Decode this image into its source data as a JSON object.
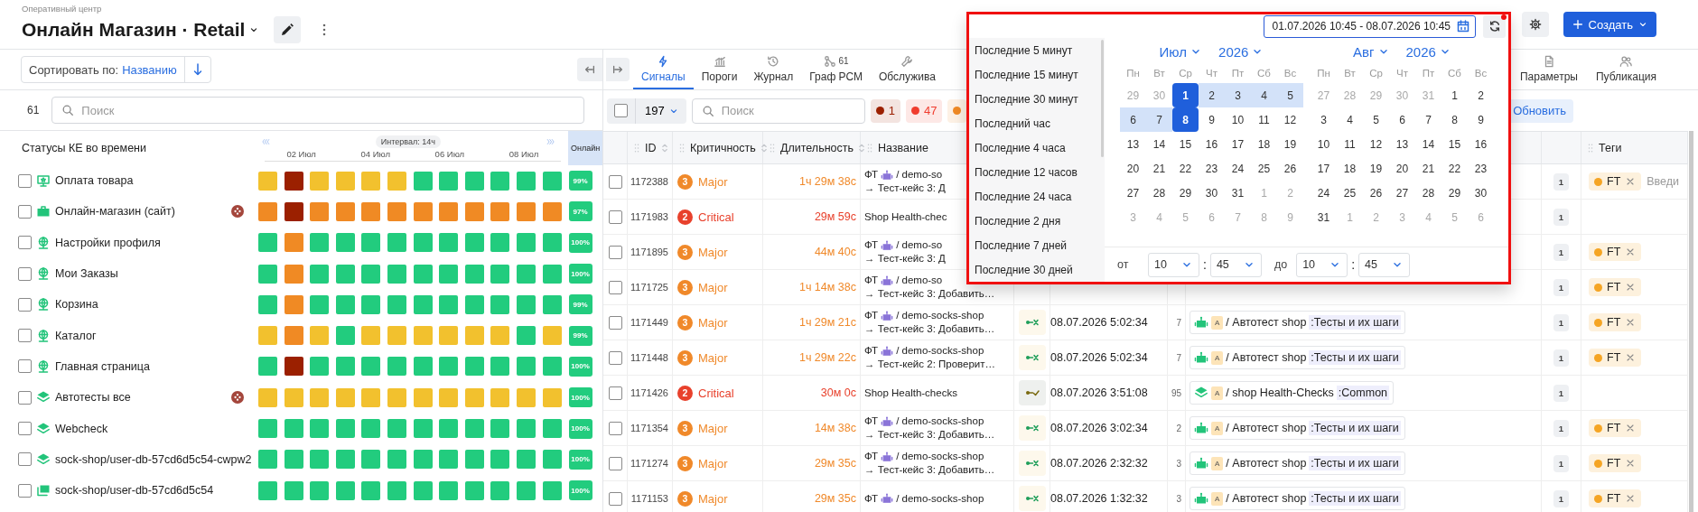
{
  "header": {
    "breadcrumb": "Оперативный центр",
    "title": "Онлайн Магазин · Retail",
    "create_button": "Создать"
  },
  "sort": {
    "label": "Сортировать по:",
    "value": "Названию"
  },
  "status_panel": {
    "count": "61",
    "search_placeholder": "Поиск",
    "title": "Статусы КЕ во времени",
    "interval": "Интервал: 14ч",
    "ticks": [
      "02 Июл",
      "04 Июл",
      "06 Июл",
      "08 Июл"
    ],
    "online_header": "Онлайн"
  },
  "status_rows": [
    {
      "name": "Оплата товара",
      "kind": "monitor",
      "checked": false,
      "alert": false,
      "uptime": "99%",
      "cells": [
        {
          "color": "#f2c12e"
        },
        {
          "color": "#9b2000"
        },
        {
          "color": "#f2c12e"
        },
        {
          "color": "#f2c12e"
        },
        {
          "color": "#f2c12e"
        },
        {
          "color": "#f2c12e"
        },
        {
          "color": "#22cc7e"
        },
        {
          "color": "#22cc7e"
        },
        {
          "color": "#22cc7e"
        },
        {
          "color": "#22cc7e"
        },
        {
          "color": "#22cc7e"
        },
        {
          "color": "#22cc7e"
        }
      ]
    },
    {
      "name": "Онлайн-магазин (сайт)",
      "kind": "briefcase",
      "checked": false,
      "alert": true,
      "uptime": "97%",
      "cells": [
        {
          "color": "#f08a24"
        },
        {
          "color": "#9b2000"
        },
        {
          "color": "#f08a24"
        },
        {
          "color": "#f08a24"
        },
        {
          "color": "#f08a24"
        },
        {
          "color": "#f08a24"
        },
        {
          "color": "#f08a24"
        },
        {
          "color": "#f08a24"
        },
        {
          "color": "#f08a24"
        },
        {
          "color": "#f08a24"
        },
        {
          "color": "#f08a24"
        },
        {
          "color": "#f08a24"
        }
      ]
    },
    {
      "name": "Настройки профиля",
      "kind": "globe",
      "checked": false,
      "alert": false,
      "uptime": "100%",
      "cells": [
        {
          "color": "#22cc7e"
        },
        {
          "color": "#f08a24"
        },
        {
          "color": "#22cc7e"
        },
        {
          "color": "#22cc7e"
        },
        {
          "color": "#22cc7e"
        },
        {
          "color": "#22cc7e"
        },
        {
          "color": "#22cc7e"
        },
        {
          "color": "#22cc7e"
        },
        {
          "color": "#22cc7e"
        },
        {
          "color": "#22cc7e"
        },
        {
          "color": "#22cc7e"
        },
        {
          "color": "#22cc7e"
        }
      ]
    },
    {
      "name": "Мои Заказы",
      "kind": "globe",
      "checked": false,
      "alert": false,
      "uptime": "100%",
      "cells": [
        {
          "color": "#22cc7e"
        },
        {
          "color": "#f08a24"
        },
        {
          "color": "#22cc7e"
        },
        {
          "color": "#22cc7e"
        },
        {
          "color": "#22cc7e"
        },
        {
          "color": "#22cc7e"
        },
        {
          "color": "#22cc7e"
        },
        {
          "color": "#22cc7e"
        },
        {
          "color": "#22cc7e"
        },
        {
          "color": "#22cc7e"
        },
        {
          "color": "#22cc7e"
        },
        {
          "color": "#22cc7e"
        }
      ]
    },
    {
      "name": "Корзина",
      "kind": "globe",
      "checked": false,
      "alert": false,
      "uptime": "99%",
      "cells": [
        {
          "color": "#22cc7e"
        },
        {
          "color": "#f08a24"
        },
        {
          "color": "#22cc7e"
        },
        {
          "color": "#22cc7e"
        },
        {
          "color": "#22cc7e"
        },
        {
          "color": "#22cc7e"
        },
        {
          "color": "#22cc7e"
        },
        {
          "color": "#22cc7e"
        },
        {
          "color": "#22cc7e"
        },
        {
          "color": "#22cc7e"
        },
        {
          "color": "#22cc7e"
        },
        {
          "color": "#22cc7e"
        }
      ]
    },
    {
      "name": "Каталог",
      "kind": "globe",
      "checked": false,
      "alert": false,
      "uptime": "99%",
      "cells": [
        {
          "color": "#f2c12e"
        },
        {
          "color": "#f08a24"
        },
        {
          "color": "#f2c12e"
        },
        {
          "color": "#22cc7e"
        },
        {
          "color": "#f2c12e"
        },
        {
          "color": "#f2c12e"
        },
        {
          "color": "#f2c12e"
        },
        {
          "color": "#f2c12e"
        },
        {
          "color": "#f2c12e"
        },
        {
          "color": "#f2c12e"
        },
        {
          "color": "#22cc7e"
        },
        {
          "color": "#f2c12e"
        }
      ]
    },
    {
      "name": "Главная страница",
      "kind": "globe",
      "checked": false,
      "alert": false,
      "uptime": "100%",
      "cells": [
        {
          "color": "#22cc7e"
        },
        {
          "color": "#9b2000"
        },
        {
          "color": "#22cc7e"
        },
        {
          "color": "#22cc7e"
        },
        {
          "color": "#22cc7e"
        },
        {
          "color": "#22cc7e"
        },
        {
          "color": "#22cc7e"
        },
        {
          "color": "#22cc7e"
        },
        {
          "color": "#22cc7e"
        },
        {
          "color": "#22cc7e"
        },
        {
          "color": "#22cc7e"
        },
        {
          "color": "#22cc7e"
        }
      ]
    },
    {
      "name": "Автотесты все",
      "kind": "layers",
      "checked": false,
      "alert": true,
      "uptime": "100%",
      "cells": [
        {
          "color": "#f2c12e"
        },
        {
          "color": "#f2c12e"
        },
        {
          "color": "#f2c12e"
        },
        {
          "color": "#f2c12e"
        },
        {
          "color": "#f2c12e"
        },
        {
          "color": "#f2c12e"
        },
        {
          "color": "#f2c12e"
        },
        {
          "color": "#f2c12e"
        },
        {
          "color": "#f2c12e"
        },
        {
          "color": "#f2c12e"
        },
        {
          "color": "#f2c12e"
        },
        {
          "color": "#f2c12e"
        }
      ]
    },
    {
      "name": "Webcheck",
      "kind": "layers",
      "checked": false,
      "alert": false,
      "uptime": "100%",
      "cells": [
        {
          "color": "#22cc7e"
        },
        {
          "color": "#22cc7e"
        },
        {
          "color": "#22cc7e"
        },
        {
          "color": "#22cc7e"
        },
        {
          "color": "#22cc7e"
        },
        {
          "color": "#22cc7e"
        },
        {
          "color": "#22cc7e"
        },
        {
          "color": "#22cc7e"
        },
        {
          "color": "#22cc7e"
        },
        {
          "color": "#22cc7e"
        },
        {
          "color": "#22cc7e"
        },
        {
          "color": "#22cc7e"
        }
      ]
    },
    {
      "name": "sock-shop/user-db-57cd6d5c54-cwpw2",
      "kind": "layers",
      "checked": false,
      "alert": false,
      "uptime": "100%",
      "cells": [
        {
          "color": "#22cc7e"
        },
        {
          "color": "#22cc7e"
        },
        {
          "color": "#22cc7e"
        },
        {
          "color": "#22cc7e"
        },
        {
          "color": "#22cc7e"
        },
        {
          "color": "#22cc7e"
        },
        {
          "color": "#22cc7e"
        },
        {
          "color": "#22cc7e"
        },
        {
          "color": "#22cc7e"
        },
        {
          "color": "#22cc7e"
        },
        {
          "color": "#22cc7e"
        },
        {
          "color": "#22cc7e"
        }
      ]
    },
    {
      "name": "sock-shop/user-db-57cd6d5c54",
      "kind": "windows",
      "checked": false,
      "alert": false,
      "uptime": "100%",
      "cells": [
        {
          "color": "#22cc7e"
        },
        {
          "color": "#22cc7e"
        },
        {
          "color": "#22cc7e"
        },
        {
          "color": "#22cc7e"
        },
        {
          "color": "#22cc7e"
        },
        {
          "color": "#22cc7e"
        },
        {
          "color": "#22cc7e"
        },
        {
          "color": "#22cc7e"
        },
        {
          "color": "#22cc7e"
        },
        {
          "color": "#22cc7e"
        },
        {
          "color": "#22cc7e"
        },
        {
          "color": "#22cc7e"
        }
      ]
    }
  ],
  "tabs": {
    "left": [
      {
        "kind": "bolt",
        "label": "Сигналы",
        "selected": true
      },
      {
        "kind": "bars",
        "label": "Пороги",
        "selected": false
      },
      {
        "kind": "history",
        "label": "Журнал",
        "selected": false
      },
      {
        "kind": "graph",
        "label": "Граф РСМ",
        "badge": "61",
        "selected": false
      },
      {
        "kind": "wrench",
        "label": "Обслужива",
        "selected": false
      }
    ],
    "right": [
      {
        "kind": "document",
        "label": "Параметры",
        "selected": false
      },
      {
        "kind": "users",
        "label": "Публикация",
        "selected": false
      }
    ]
  },
  "toolbar": {
    "select_all_checked": false,
    "page_size": "197",
    "search_placeholder": "Поиск",
    "severity_chips": [
      {
        "color": "#9b2000",
        "count": "1"
      },
      {
        "color": "#f03c2e",
        "count": "47"
      },
      {
        "color": "#f08a24"
      }
    ],
    "refresh_button": "Обновить"
  },
  "table": {
    "columns": [
      {
        "label": "ID",
        "sortable": true
      },
      {
        "label": "Критичность",
        "sortable": true
      },
      {
        "label": "Длительность",
        "sortable": true
      },
      {
        "label": "Название",
        "sortable": false
      }
    ],
    "trailing_columns": [
      {
        "label": "Теги",
        "sortable": false
      }
    ],
    "rows": [
      {
        "id": "1172388",
        "checked": false,
        "severity": {
          "number": "3",
          "label": "Major",
          "kind": "major"
        },
        "duration": "1ч 29м 38с",
        "name": {
          "prefix": "ФТ",
          "path": "/ demo-so",
          "detail": "→ Тест-кейс 3: Д"
        },
        "occurrences": "1",
        "tags": [
          {
            "label": "FT",
            "color": "#f5a524"
          }
        ],
        "tag_placeholder": "Введи"
      },
      {
        "id": "1171983",
        "checked": false,
        "severity": {
          "number": "2",
          "label": "Critical",
          "kind": "critical"
        },
        "duration": "29м 59с",
        "name": {
          "text": "Shop Health-chec"
        },
        "occurrences": "1"
      },
      {
        "id": "1171895",
        "checked": false,
        "severity": {
          "number": "3",
          "label": "Major",
          "kind": "major"
        },
        "duration": "44м 40с",
        "name": {
          "prefix": "ФТ",
          "path": "/ demo-so",
          "detail": "→ Тест-кейс 3: Д"
        },
        "occurrences": "1",
        "tags": [
          {
            "label": "FT",
            "color": "#f5a524"
          }
        ]
      },
      {
        "id": "1171725",
        "checked": false,
        "severity": {
          "number": "3",
          "label": "Major",
          "kind": "major"
        },
        "duration": "1ч 14м 38с",
        "name": {
          "prefix": "ФТ",
          "path": "/ demo-so",
          "detail": "→ Тест-кейс 3: Добавить…"
        },
        "occurrences": "1",
        "tags": [
          {
            "label": "FT",
            "color": "#f5a524"
          }
        ]
      },
      {
        "id": "1171449",
        "checked": false,
        "severity": {
          "number": "3",
          "label": "Major",
          "kind": "major"
        },
        "duration": "1ч 29м 21с",
        "name": {
          "prefix": "ФТ",
          "path": "/ demo-socks-shop",
          "detail": "→ Тест-кейс 3: Добавить…"
        },
        "signal": {
          "kind": "failed",
          "time": "08.07.2026 5:02:34",
          "count": "7",
          "source": {
            "kind": "robot",
            "badge": "A",
            "path": "/ Автотест shop",
            "group": ":Тесты и их шаги"
          }
        },
        "occurrences": "1",
        "tags": [
          {
            "label": "FT",
            "color": "#f5a524"
          }
        ]
      },
      {
        "id": "1171448",
        "checked": false,
        "severity": {
          "number": "3",
          "label": "Major",
          "kind": "major"
        },
        "duration": "1ч 29м 22с",
        "name": {
          "prefix": "ФТ",
          "path": "/ demo-socks-shop",
          "detail": "→ Тест-кейс 2: Проверит…"
        },
        "signal": {
          "kind": "failed",
          "time": "08.07.2026 5:02:34",
          "count": "7",
          "source": {
            "kind": "robot",
            "badge": "A",
            "path": "/ Автотест shop",
            "group": ":Тесты и их шаги"
          }
        },
        "occurrences": "1",
        "tags": [
          {
            "label": "FT",
            "color": "#f5a524"
          }
        ]
      },
      {
        "id": "1171426",
        "checked": false,
        "severity": {
          "number": "2",
          "label": "Critical",
          "kind": "critical"
        },
        "duration": "30м 0с",
        "name": {
          "text": "Shop Health-checks"
        },
        "signal": {
          "kind": "passed",
          "time": "08.07.2026 3:51:08",
          "count": "95",
          "source": {
            "kind": "layers",
            "badge": "A",
            "path": "/ shop Health-Checks",
            "group": ":Common"
          }
        },
        "occurrences": "1"
      },
      {
        "id": "1171354",
        "checked": false,
        "severity": {
          "number": "3",
          "label": "Major",
          "kind": "major"
        },
        "duration": "14м 38с",
        "name": {
          "prefix": "ФТ",
          "path": "/ demo-socks-shop",
          "detail": "→ Тест-кейс 3: Добавить…"
        },
        "signal": {
          "kind": "failed",
          "time": "08.07.2026 3:02:34",
          "count": "2",
          "source": {
            "kind": "robot",
            "badge": "A",
            "path": "/ Автотест shop",
            "group": ":Тесты и их шаги"
          }
        },
        "occurrences": "1",
        "tags": [
          {
            "label": "FT",
            "color": "#f5a524"
          }
        ]
      },
      {
        "id": "1171274",
        "checked": false,
        "severity": {
          "number": "3",
          "label": "Major",
          "kind": "major"
        },
        "duration": "29м 35с",
        "name": {
          "prefix": "ФТ",
          "path": "/ demo-socks-shop",
          "detail": "→ Тест-кейс 3: Добавить…"
        },
        "signal": {
          "kind": "failed",
          "time": "08.07.2026 2:32:32",
          "count": "3",
          "source": {
            "kind": "robot",
            "badge": "A",
            "path": "/ Автотест shop",
            "group": ":Тесты и их шаги"
          }
        },
        "occurrences": "1",
        "tags": [
          {
            "label": "FT",
            "color": "#f5a524"
          }
        ]
      },
      {
        "id": "1171153",
        "checked": false,
        "severity": {
          "number": "3",
          "label": "Major",
          "kind": "major"
        },
        "duration": "29м 35с",
        "name": {
          "prefix": "ФТ",
          "path": "/ demo-socks-shop"
        },
        "signal": {
          "kind": "failed",
          "time": "08.07.2026 1:32:32",
          "count": "3",
          "source": {
            "kind": "robot",
            "badge": "A",
            "path": "/ Автотест shop",
            "group": ":Тесты и их шаги"
          }
        },
        "occurrences": "1",
        "tags": [
          {
            "label": "FT",
            "color": "#f5a524"
          }
        ]
      }
    ]
  },
  "date_picker": {
    "range": "01.07.2026 10:45 - 08.07.2026 10:45",
    "presets": [
      {
        "label": "Последние 5 минут",
        "selected": false
      },
      {
        "label": "Последние 15 минут",
        "selected": false
      },
      {
        "label": "Последние 30 минут",
        "selected": false
      },
      {
        "label": "Последний час",
        "selected": false
      },
      {
        "label": "Последние 4 часа",
        "selected": false
      },
      {
        "label": "Последние 12 часов",
        "selected": false
      },
      {
        "label": "Последние 24 часа",
        "selected": false
      },
      {
        "label": "Последние 2 дня",
        "selected": false
      },
      {
        "label": "Последние 7 дней",
        "selected": false
      },
      {
        "label": "Последние 30 дней",
        "selected": false
      }
    ],
    "months": [
      {
        "month": "Июл",
        "year": "2026",
        "weekdays": [
          "Пн",
          "Вт",
          "Ср",
          "Чт",
          "Пт",
          "Сб",
          "Вс"
        ],
        "weeks": [
          [
            {
              "day": "29",
              "outside": true,
              "selected": false,
              "in_range": false
            },
            {
              "day": "30",
              "outside": true,
              "selected": false,
              "in_range": false
            },
            {
              "day": "1",
              "outside": false,
              "selected": true,
              "in_range": false
            },
            {
              "day": "2",
              "outside": false,
              "selected": false,
              "in_range": true
            },
            {
              "day": "3",
              "outside": false,
              "selected": false,
              "in_range": true
            },
            {
              "day": "4",
              "outside": false,
              "selected": false,
              "in_range": true
            },
            {
              "day": "5",
              "outside": false,
              "selected": false,
              "in_range": true
            }
          ],
          [
            {
              "day": "6",
              "outside": false,
              "selected": false,
              "in_range": true
            },
            {
              "day": "7",
              "outside": false,
              "selected": false,
              "in_range": true
            },
            {
              "day": "8",
              "outside": false,
              "selected": true,
              "in_range": false
            },
            {
              "day": "9",
              "outside": false,
              "selected": false,
              "in_range": false
            },
            {
              "day": "10",
              "outside": false,
              "selected": false,
              "in_range": false
            },
            {
              "day": "11",
              "outside": false,
              "selected": false,
              "in_range": false
            },
            {
              "day": "12",
              "outside": false,
              "selected": false,
              "in_range": false
            }
          ],
          [
            {
              "day": "13",
              "outside": false,
              "selected": false,
              "in_range": false
            },
            {
              "day": "14",
              "outside": false,
              "selected": false,
              "in_range": false
            },
            {
              "day": "15",
              "outside": false,
              "selected": false,
              "in_range": false
            },
            {
              "day": "16",
              "outside": false,
              "selected": false,
              "in_range": false
            },
            {
              "day": "17",
              "outside": false,
              "selected": false,
              "in_range": false
            },
            {
              "day": "18",
              "outside": false,
              "selected": false,
              "in_range": false
            },
            {
              "day": "19",
              "outside": false,
              "selected": false,
              "in_range": false
            }
          ],
          [
            {
              "day": "20",
              "outside": false,
              "selected": false,
              "in_range": false
            },
            {
              "day": "21",
              "outside": false,
              "selected": false,
              "in_range": false
            },
            {
              "day": "22",
              "outside": false,
              "selected": false,
              "in_range": false
            },
            {
              "day": "23",
              "outside": false,
              "selected": false,
              "in_range": false
            },
            {
              "day": "24",
              "outside": false,
              "selected": false,
              "in_range": false
            },
            {
              "day": "25",
              "outside": false,
              "selected": false,
              "in_range": false
            },
            {
              "day": "26",
              "outside": false,
              "selected": false,
              "in_range": false
            }
          ],
          [
            {
              "day": "27",
              "outside": false,
              "selected": false,
              "in_range": false
            },
            {
              "day": "28",
              "outside": false,
              "selected": false,
              "in_range": false
            },
            {
              "day": "29",
              "outside": false,
              "selected": false,
              "in_range": false
            },
            {
              "day": "30",
              "outside": false,
              "selected": false,
              "in_range": false
            },
            {
              "day": "31",
              "outside": false,
              "selected": false,
              "in_range": false
            },
            {
              "day": "1",
              "outside": true,
              "selected": false,
              "in_range": false
            },
            {
              "day": "2",
              "outside": true,
              "selected": false,
              "in_range": false
            }
          ],
          [
            {
              "day": "3",
              "outside": true,
              "selected": false,
              "in_range": false
            },
            {
              "day": "4",
              "outside": true,
              "selected": false,
              "in_range": false
            },
            {
              "day": "5",
              "outside": true,
              "selected": false,
              "in_range": false
            },
            {
              "day": "6",
              "outside": true,
              "selected": false,
              "in_range": false
            },
            {
              "day": "7",
              "outside": true,
              "selected": false,
              "in_range": false
            },
            {
              "day": "8",
              "outside": true,
              "selected": false,
              "in_range": false
            },
            {
              "day": "9",
              "outside": true,
              "selected": false,
              "in_range": false
            }
          ]
        ]
      },
      {
        "month": "Авг",
        "year": "2026",
        "weekdays": [
          "Пн",
          "Вт",
          "Ср",
          "Чт",
          "Пт",
          "Сб",
          "Вс"
        ],
        "weeks": [
          [
            {
              "day": "27",
              "outside": true,
              "selected": false,
              "in_range": false
            },
            {
              "day": "28",
              "outside": true,
              "selected": false,
              "in_range": false
            },
            {
              "day": "29",
              "outside": true,
              "selected": false,
              "in_range": false
            },
            {
              "day": "30",
              "outside": true,
              "selected": false,
              "in_range": false
            },
            {
              "day": "31",
              "outside": true,
              "selected": false,
              "in_range": false
            },
            {
              "day": "1",
              "outside": false,
              "selected": false,
              "in_range": false
            },
            {
              "day": "2",
              "outside": false,
              "selected": false,
              "in_range": false
            }
          ],
          [
            {
              "day": "3",
              "outside": false,
              "selected": false,
              "in_range": false
            },
            {
              "day": "4",
              "outside": false,
              "selected": false,
              "in_range": false
            },
            {
              "day": "5",
              "outside": false,
              "selected": false,
              "in_range": false
            },
            {
              "day": "6",
              "outside": false,
              "selected": false,
              "in_range": false
            },
            {
              "day": "7",
              "outside": false,
              "selected": false,
              "in_range": false
            },
            {
              "day": "8",
              "outside": false,
              "selected": false,
              "in_range": false
            },
            {
              "day": "9",
              "outside": false,
              "selected": false,
              "in_range": false
            }
          ],
          [
            {
              "day": "10",
              "outside": false,
              "selected": false,
              "in_range": false
            },
            {
              "day": "11",
              "outside": false,
              "selected": false,
              "in_range": false
            },
            {
              "day": "12",
              "outside": false,
              "selected": false,
              "in_range": false
            },
            {
              "day": "13",
              "outside": false,
              "selected": false,
              "in_range": false
            },
            {
              "day": "14",
              "outside": false,
              "selected": false,
              "in_range": false
            },
            {
              "day": "15",
              "outside": false,
              "selected": false,
              "in_range": false
            },
            {
              "day": "16",
              "outside": false,
              "selected": false,
              "in_range": false
            }
          ],
          [
            {
              "day": "17",
              "outside": false,
              "selected": false,
              "in_range": false
            },
            {
              "day": "18",
              "outside": false,
              "selected": false,
              "in_range": false
            },
            {
              "day": "19",
              "outside": false,
              "selected": false,
              "in_range": false
            },
            {
              "day": "20",
              "outside": false,
              "selected": false,
              "in_range": false
            },
            {
              "day": "21",
              "outside": false,
              "selected": false,
              "in_range": false
            },
            {
              "day": "22",
              "outside": false,
              "selected": false,
              "in_range": false
            },
            {
              "day": "23",
              "outside": false,
              "selected": false,
              "in_range": false
            }
          ],
          [
            {
              "day": "24",
              "outside": false,
              "selected": false,
              "in_range": false
            },
            {
              "day": "25",
              "outside": false,
              "selected": false,
              "in_range": false
            },
            {
              "day": "26",
              "outside": false,
              "selected": false,
              "in_range": false
            },
            {
              "day": "27",
              "outside": false,
              "selected": false,
              "in_range": false
            },
            {
              "day": "28",
              "outside": false,
              "selected": false,
              "in_range": false
            },
            {
              "day": "29",
              "outside": false,
              "selected": false,
              "in_range": false
            },
            {
              "day": "30",
              "outside": false,
              "selected": false,
              "in_range": false
            }
          ],
          [
            {
              "day": "31",
              "outside": false,
              "selected": false,
              "in_range": false
            },
            {
              "day": "1",
              "outside": true,
              "selected": false,
              "in_range": false
            },
            {
              "day": "2",
              "outside": true,
              "selected": false,
              "in_range": false
            },
            {
              "day": "3",
              "outside": true,
              "selected": false,
              "in_range": false
            },
            {
              "day": "4",
              "outside": true,
              "selected": false,
              "in_range": false
            },
            {
              "day": "5",
              "outside": true,
              "selected": false,
              "in_range": false
            },
            {
              "day": "6",
              "outside": true,
              "selected": false,
              "in_range": false
            }
          ]
        ]
      }
    ],
    "from_label": "от",
    "from_hour": "10",
    "from_separator": ":",
    "from_minute": "45",
    "to_label": "до",
    "to_hour": "10",
    "to_separator": ":",
    "to_minute": "45"
  }
}
